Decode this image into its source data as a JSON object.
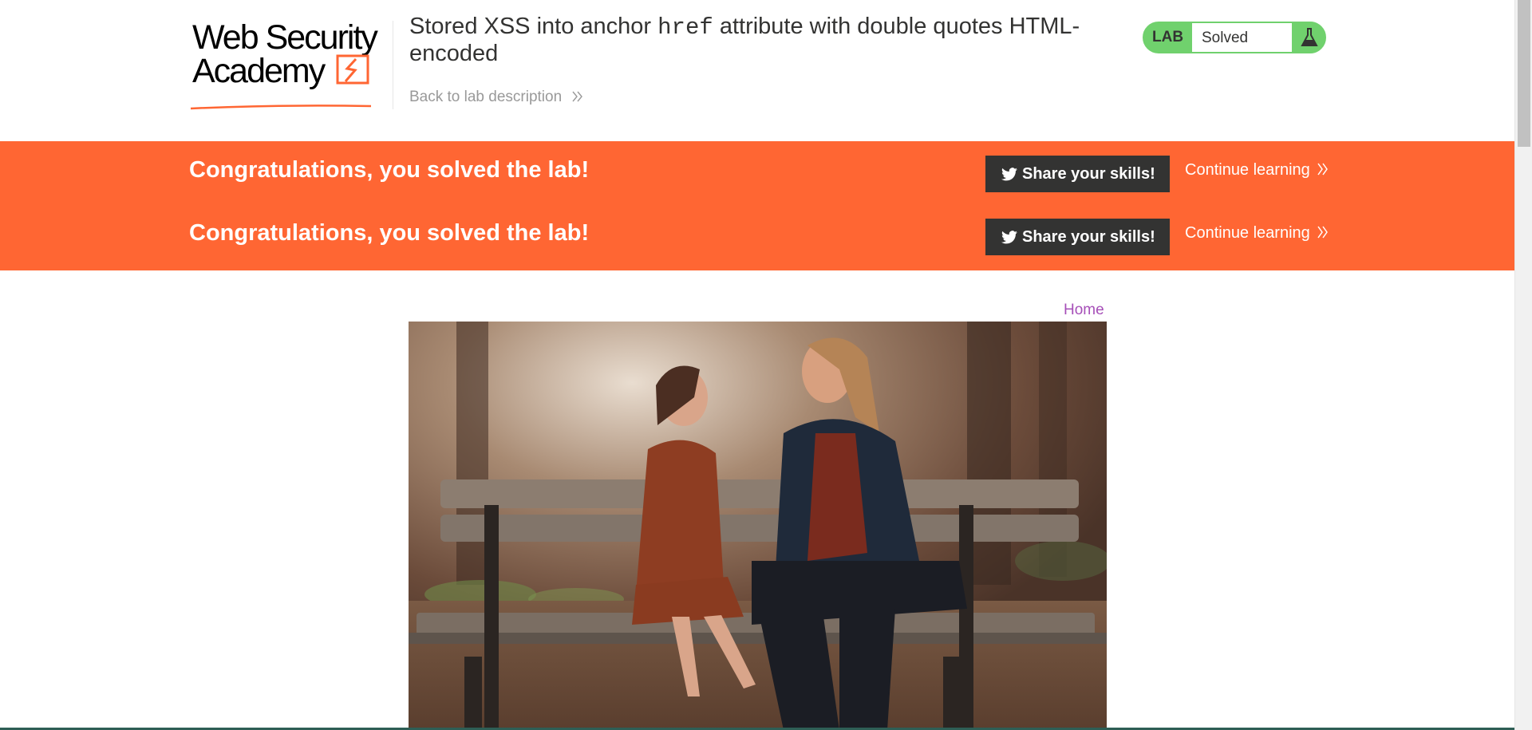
{
  "header": {
    "logo_line1": "Web Security",
    "logo_line2": "Academy",
    "title_before": "Stored XSS into anchor ",
    "title_code": "href",
    "title_after": " attribute with double quotes HTML-encoded",
    "back_link": "Back to lab description"
  },
  "lab_status": {
    "label": "LAB",
    "status": "Solved",
    "color": "#70d16d"
  },
  "notifications": [
    {
      "message": "Congratulations, you solved the lab!",
      "share_label": "Share your skills!",
      "continue_label": "Continue learning"
    },
    {
      "message": "Congratulations, you solved the lab!",
      "share_label": "Share your skills!",
      "continue_label": "Continue learning"
    }
  ],
  "nav": {
    "home": "Home"
  },
  "colors": {
    "accent": "#ff6633",
    "link": "#a64fb8",
    "dark": "#333332"
  },
  "icons": [
    "twitter-icon",
    "chevron-right-double-icon",
    "flask-icon"
  ]
}
